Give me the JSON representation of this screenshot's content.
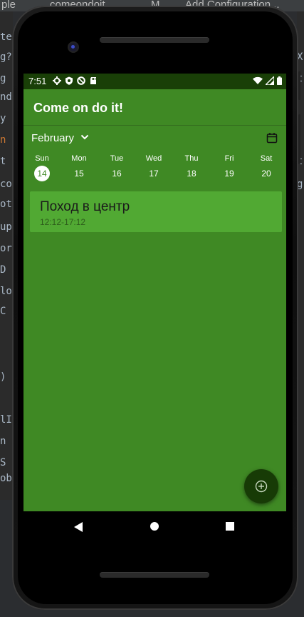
{
  "ide": {
    "tabs": [
      "ple",
      "comeondoit",
      "M",
      "Add Configuration..."
    ],
    "left_fragments": [
      "ter",
      "g?",
      "g",
      "nd",
      "y",
      "n",
      "t",
      "co",
      "ot",
      "up",
      "or",
      "D",
      "lo",
      "C",
      ")",
      "lI",
      "n",
      "S",
      "ob"
    ],
    "right_fragments": [
      "X",
      "t",
      "t",
      "g"
    ]
  },
  "status_bar": {
    "time": "7:51",
    "left_icons": [
      "gear-icon",
      "shield-icon",
      "data-saver-icon",
      "sd-card-icon"
    ],
    "right_icons": [
      "wifi-icon",
      "signal-icon",
      "battery-icon"
    ]
  },
  "app_bar": {
    "title": "Come on do it!"
  },
  "calendar": {
    "month": "February",
    "days": [
      {
        "name": "Sun",
        "num": "14",
        "selected": true
      },
      {
        "name": "Mon",
        "num": "15"
      },
      {
        "name": "Tue",
        "num": "16"
      },
      {
        "name": "Wed",
        "num": "17"
      },
      {
        "name": "Thu",
        "num": "18"
      },
      {
        "name": "Fri",
        "num": "19"
      },
      {
        "name": "Sat",
        "num": "20"
      }
    ]
  },
  "events": [
    {
      "title": "Поход в центр",
      "time": "12:12-17:12"
    }
  ],
  "fab": {
    "icon": "add-circle-icon"
  },
  "colors": {
    "primary": "#3f8924",
    "primary_dark": "#193f07",
    "event_card": "#51a933",
    "fab": "#173b06"
  }
}
